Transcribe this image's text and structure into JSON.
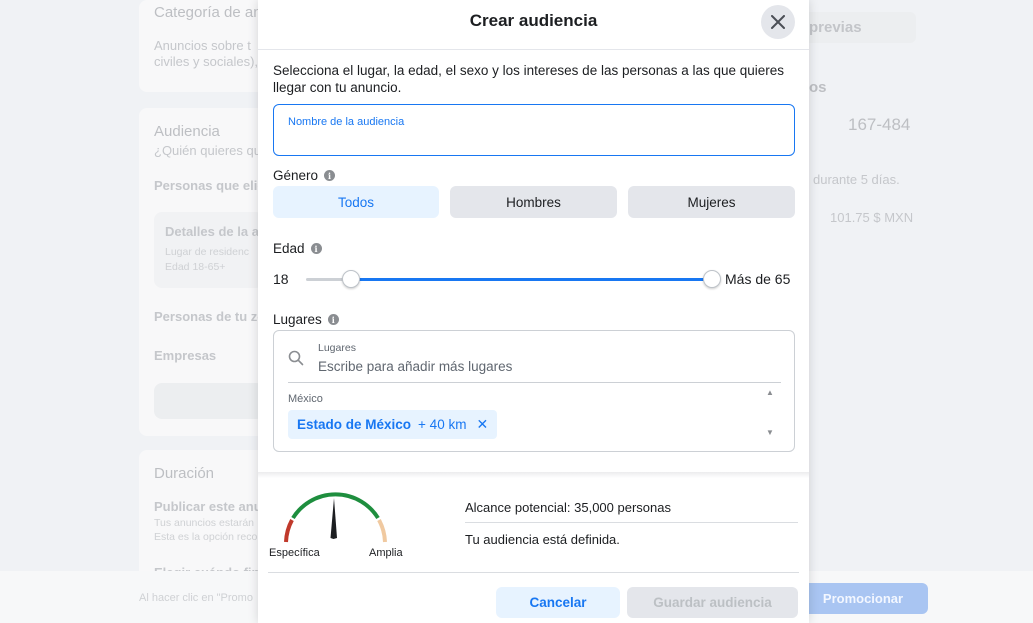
{
  "background": {
    "category_title": "Categoría de an",
    "category_desc_1": "Anuncios sobre t",
    "category_desc_2": "civiles y sociales),",
    "audience_title": "Audiencia",
    "audience_sub": "¿Quién quieres qu",
    "people_choose": "Personas que elig",
    "details_title": "Detalles de la a",
    "details_line_1": "Lugar de residenc",
    "details_line_2": "Edad 18-65+",
    "people_zone": "Personas de tu zo",
    "companies": "Empresas",
    "duration_title": "Duración",
    "publish_title": "Publicar este anu",
    "publish_line_1": "Tus anuncios estarán",
    "publish_line_2": "Esta es la opción reco",
    "choose_end": "Elegir cuándo fin",
    "footer_text": "Al hacer clic en \"Promo",
    "previews_label": "previas",
    "right_label_os": "os",
    "right_range": "167-484",
    "right_days": "durante 5 días.",
    "right_amount": "101.75 $ MXN",
    "promote_label": "Promocionar"
  },
  "modal": {
    "title": "Crear audiencia",
    "intro": "Selecciona el lugar, la edad, el sexo y los intereses de las personas a las que quieres llegar con tu anuncio.",
    "audience_name": {
      "label": "Nombre de la audiencia",
      "value": ""
    },
    "gender": {
      "label": "Género",
      "options": [
        "Todos",
        "Hombres",
        "Mujeres"
      ],
      "selected": "Todos"
    },
    "age": {
      "label": "Edad",
      "min_label": "18",
      "max_label": "Más de 65",
      "min": 18,
      "max": 65
    },
    "places": {
      "label": "Lugares",
      "search_label": "Lugares",
      "search_placeholder": "Escribe para añadir más lugares",
      "country": "México",
      "chip_name": "Estado de México",
      "chip_radius": "+ 40 km",
      "chip_remove": "✕"
    },
    "reach": {
      "gauge_left": "Específica",
      "gauge_right": "Amplia",
      "potential": "Alcance potencial: 35,000 personas",
      "status": "Tu audiencia está definida."
    },
    "buttons": {
      "cancel": "Cancelar",
      "save": "Guardar audiencia"
    },
    "colors": {
      "accent": "#1877f2",
      "accent_light": "#e7f3ff",
      "gauge_red": "#c0392b",
      "gauge_green": "#1e8e3e",
      "gauge_tan": "#f0c9a0"
    }
  }
}
